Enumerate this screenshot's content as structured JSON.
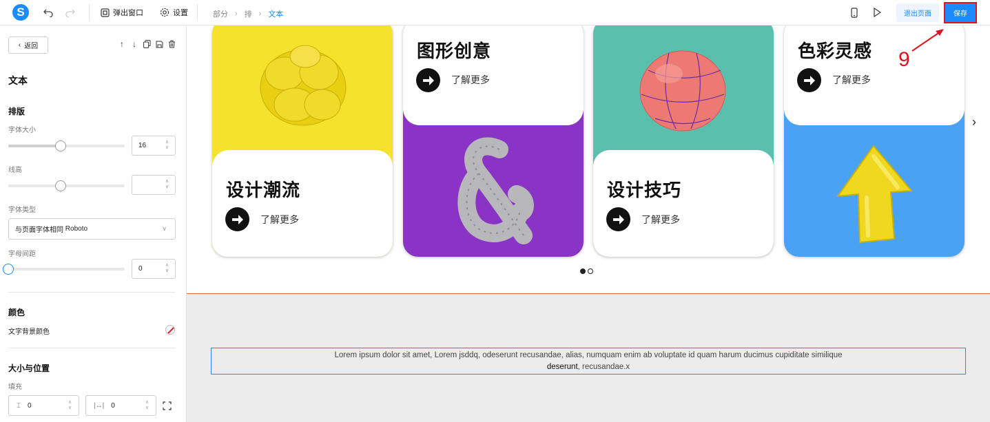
{
  "header": {
    "logo_letter": "S",
    "popup_label": "弹出窗口",
    "settings_label": "设置",
    "breadcrumb": [
      "部分",
      "排",
      "文本"
    ],
    "exit_label": "退出页面",
    "save_label": "保存"
  },
  "sidebar": {
    "back_label": "返回",
    "title": "文本",
    "typography": {
      "section": "排版",
      "font_size_label": "字体大小",
      "font_size_value": "16",
      "font_size_slider": 0.45,
      "line_height_label": "线高",
      "line_height_value": "",
      "line_height_slider": 0.45,
      "font_type_label": "字体类型",
      "font_type_value": "与页面字体相同",
      "font_type_font": "Roboto",
      "letter_spacing_label": "字母间距",
      "letter_spacing_value": "0",
      "letter_spacing_slider": 0
    },
    "color": {
      "section": "颜色",
      "bg_label": "文字背景颜色"
    },
    "size_position": {
      "section": "大小与位置",
      "fill_label": "填充",
      "padding_v": "0",
      "padding_h": "0"
    }
  },
  "canvas": {
    "cards": [
      {
        "title": "设计潮流",
        "more": "了解更多",
        "color": "#f5e22a",
        "panel": "bottom"
      },
      {
        "title": "图形创意",
        "more": "了解更多",
        "color": "#8a34c6",
        "panel": "top"
      },
      {
        "title": "设计技巧",
        "more": "了解更多",
        "color": "#5bbfad",
        "panel": "bottom"
      },
      {
        "title": "色彩灵感",
        "more": "了解更多",
        "color": "#4aa2f5",
        "panel": "top"
      }
    ],
    "text_line1": "Lorem ipsum dolor sit amet, Lorem jsddq, odeserunt recusandae, alias, numquam enim ab voluptate id quam harum ducimus cupiditate similique",
    "text_bold": "deserunt",
    "text_rest": ", recusandae.x"
  },
  "annotation": {
    "number": "9",
    "color": "#e0141e"
  },
  "colors": {
    "accent": "#1a8cff",
    "highlight": "#e0141e"
  }
}
